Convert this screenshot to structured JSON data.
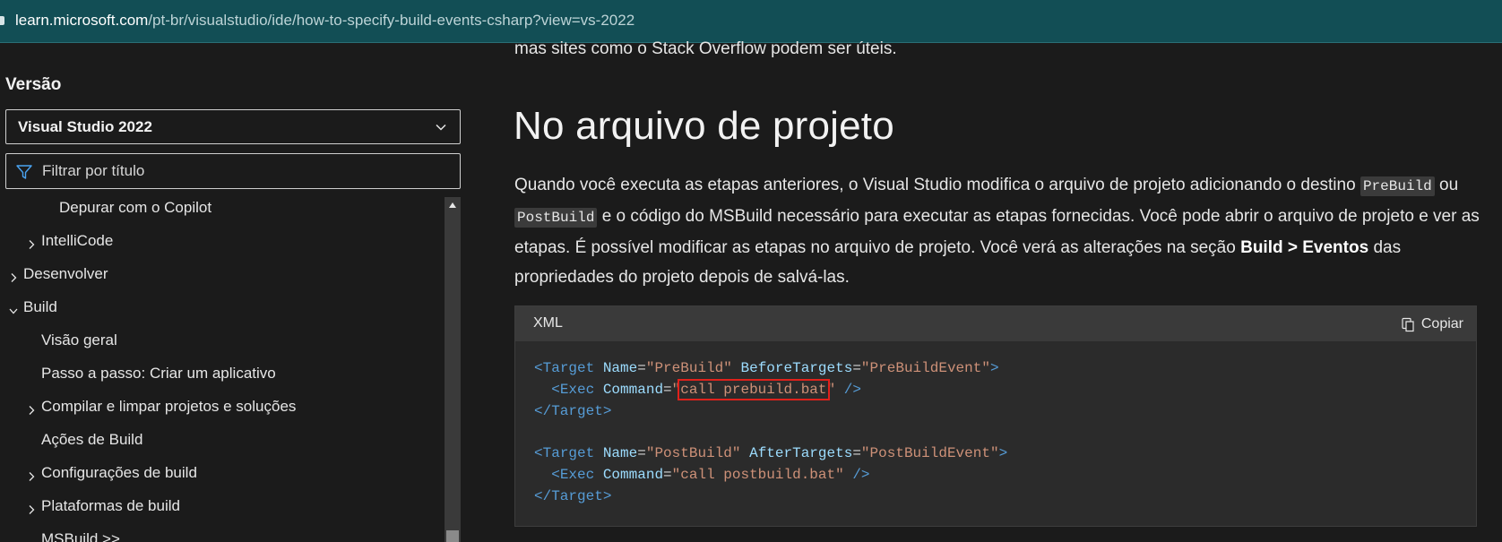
{
  "browser": {
    "url_host": "learn.microsoft.com",
    "url_path": "/pt-br/visualstudio/ide/how-to-specify-build-events-csharp?view=vs-2022"
  },
  "sidebar": {
    "version_label": "Versão",
    "version_value": "Visual Studio 2022",
    "filter_placeholder": "Filtrar por título",
    "toc": [
      {
        "label": "Depurar com o Copilot",
        "chevron": "none"
      },
      {
        "label": "IntelliCode",
        "chevron": "right"
      },
      {
        "label": "Desenvolver",
        "chevron": "right"
      },
      {
        "label": "Build",
        "chevron": "down"
      },
      {
        "label": "Visão geral",
        "chevron": "none"
      },
      {
        "label": "Passo a passo: Criar um aplicativo",
        "chevron": "none"
      },
      {
        "label": "Compilar e limpar projetos e soluções",
        "chevron": "right"
      },
      {
        "label": "Ações de Build",
        "chevron": "none"
      },
      {
        "label": "Configurações de build",
        "chevron": "right"
      },
      {
        "label": "Plataformas de build",
        "chevron": "right"
      },
      {
        "label": "MSBuild >>",
        "chevron": "none"
      }
    ]
  },
  "main": {
    "top_text": "mas sites como o Stack Overflow podem ser úteis.",
    "heading": "No arquivo de projeto",
    "para": {
      "p1": "Quando você executa as etapas anteriores, o Visual Studio modifica o arquivo de projeto adicionando o destino",
      "code1": "PreBuild",
      "p2": "ou",
      "code2": "PostBuild",
      "p3": "e o código do MSBuild necessário para executar as etapas fornecidas. Você pode abrir o arquivo de projeto e ver as etapas. É possível modificar as etapas no arquivo de projeto. Você verá as alterações na seção",
      "bold1": "Build > Eventos",
      "p4": "das propriedades do projeto depois de salvá-las."
    },
    "code": {
      "language": "XML",
      "copy_label": "Copiar",
      "tag_target": "Target",
      "tag_exec": "Exec",
      "attr_name": "Name",
      "attr_before": "BeforeTargets",
      "attr_after": "AfterTargets",
      "attr_command": "Command",
      "val_prebuild": "PreBuild",
      "val_prebuildevent": "PreBuildEvent",
      "val_postbuild": "PostBuild",
      "val_postbuildevent": "PostBuildEvent",
      "cmd_pre": "call prebuild.bat",
      "cmd_post": "call postbuild.bat"
    }
  },
  "colors": {
    "urlbar": "#124e55",
    "page_bg": "#1b1b1b",
    "code_bg": "#2b2b2b",
    "highlight_box": "#e0211b"
  }
}
